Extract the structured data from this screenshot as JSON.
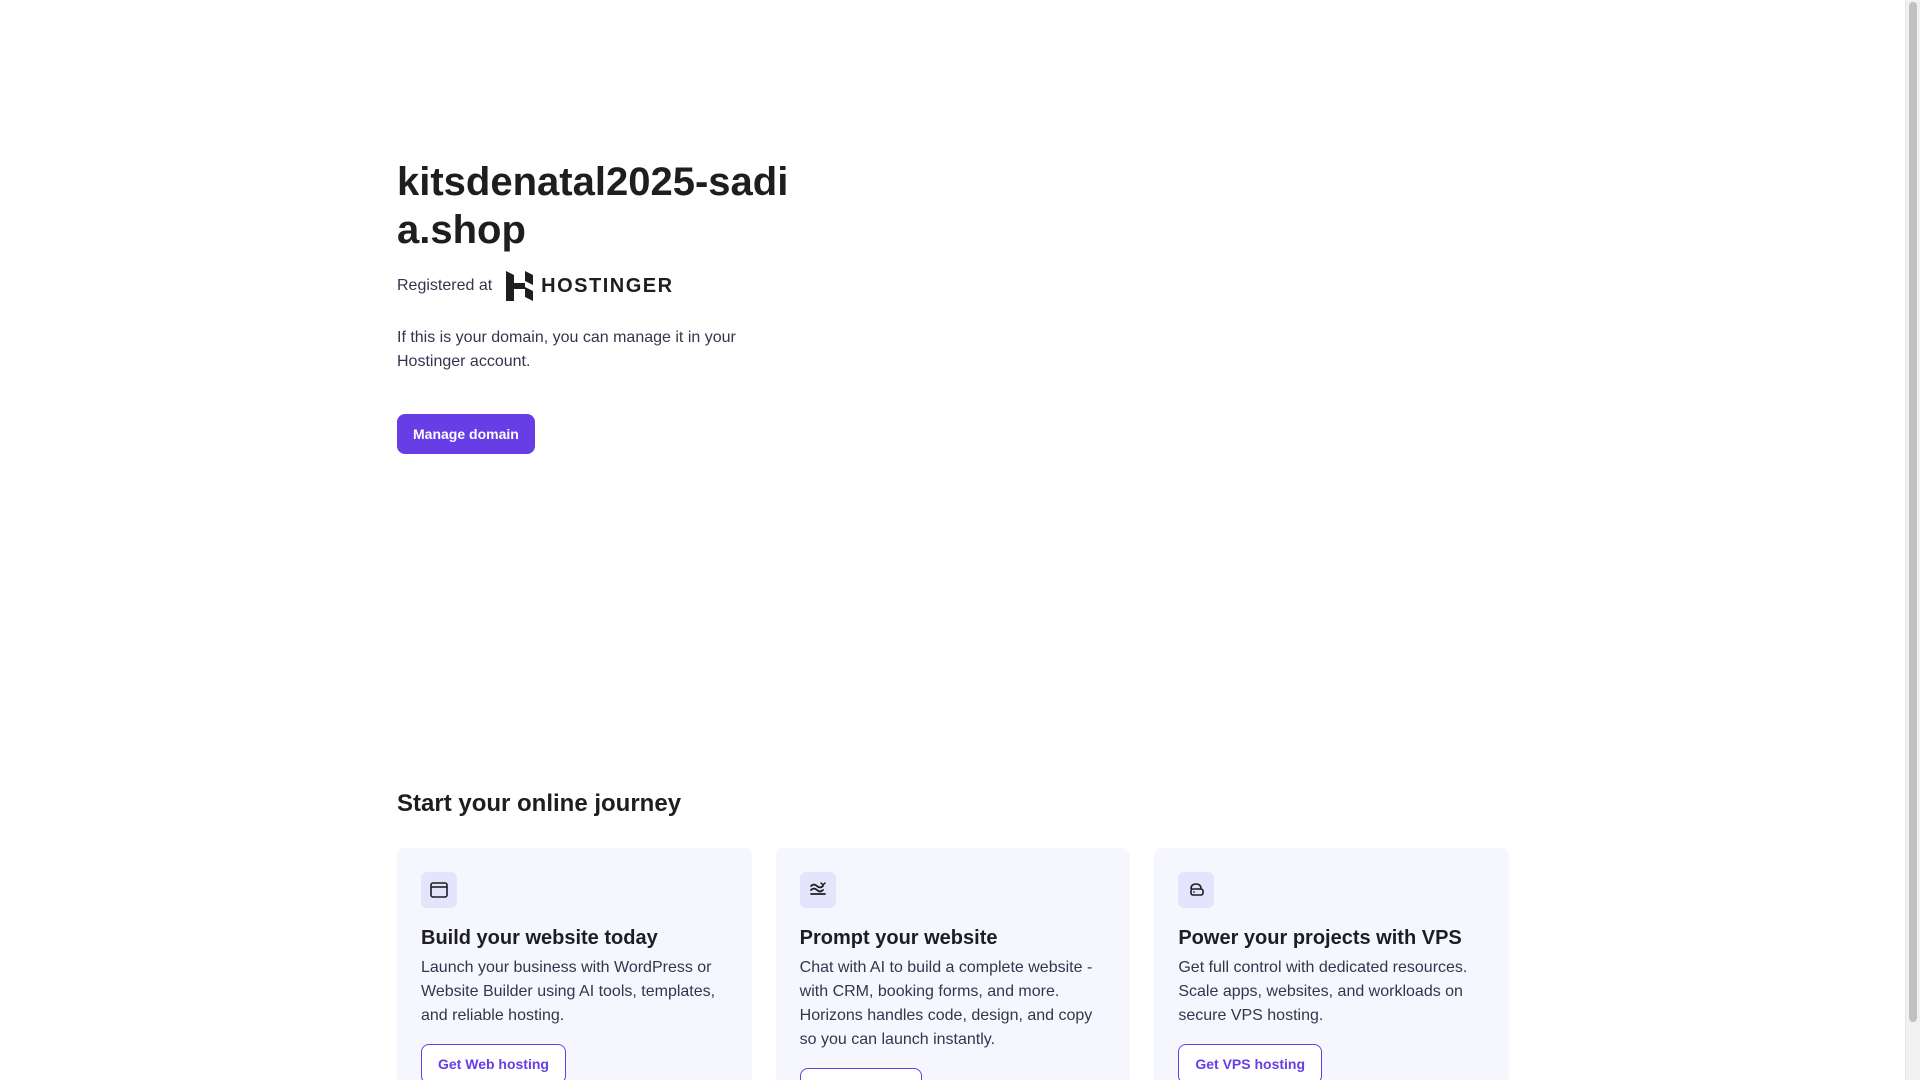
{
  "hero": {
    "domain": "kitsdenatal2025-sadia.shop",
    "registered_label": "Registered at",
    "brand_name": "HOSTINGER",
    "manage_text": "If this is your domain, you can manage it in your Hostinger account.",
    "manage_button": "Manage domain"
  },
  "journey": {
    "title": "Start your online journey",
    "cards": [
      {
        "icon": "browser-window-icon",
        "title": "Build your website today",
        "description": "Launch your business with WordPress or Website Builder using AI tools, templates, and reliable hosting.",
        "button": "Get Web hosting"
      },
      {
        "icon": "ai-waves-icon",
        "title": "Prompt your website",
        "description": "Chat with AI to build a complete website - with CRM, booking forms, and more. Horizons handles code, design, and copy so you can launch instantly.",
        "button": ""
      },
      {
        "icon": "server-cloud-icon",
        "title": "Power your projects with VPS",
        "description": "Get full control with dedicated resources. Scale apps, websites, and workloads on secure VPS hosting.",
        "button": "Get VPS hosting"
      }
    ]
  },
  "colors": {
    "primary": "#673de6",
    "card_bg": "#f6f6fe",
    "icon_bg": "#e6e3fc",
    "text": "#1d1e20"
  }
}
